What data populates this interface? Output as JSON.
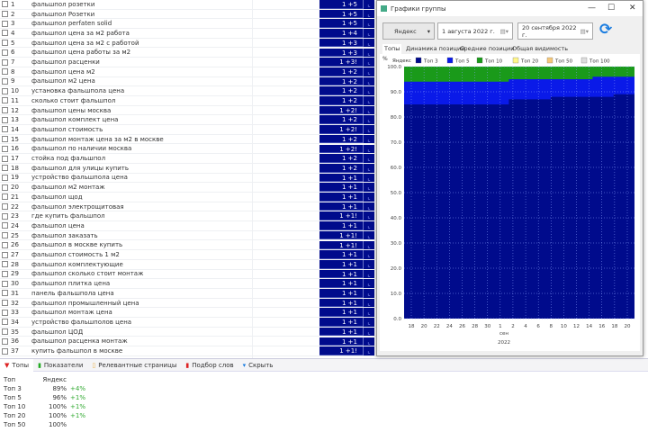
{
  "keywords": [
    {
      "n": "1",
      "kw": "фальшпол розетки",
      "pos": "1 +5"
    },
    {
      "n": "2",
      "kw": "фальшпол Розетки",
      "pos": "1 +5"
    },
    {
      "n": "3",
      "kw": "фальшпол perfaten solid",
      "pos": "1 +5"
    },
    {
      "n": "4",
      "kw": "фальшпол цена за м2 работа",
      "pos": "1 +4"
    },
    {
      "n": "5",
      "kw": "фальшпол цена за м2 с работой",
      "pos": "1 +3"
    },
    {
      "n": "6",
      "kw": "фальшпол цена работы за м2",
      "pos": "1 +3"
    },
    {
      "n": "7",
      "kw": "фальшпол расценки",
      "pos": "1 +3!"
    },
    {
      "n": "8",
      "kw": "фальшпол цена м2",
      "pos": "1 +2"
    },
    {
      "n": "9",
      "kw": "фальшпол м2 цена",
      "pos": "1 +2"
    },
    {
      "n": "10",
      "kw": "установка фальшпола цена",
      "pos": "1 +2"
    },
    {
      "n": "11",
      "kw": "сколько стоит фальшпол",
      "pos": "1 +2"
    },
    {
      "n": "12",
      "kw": "фальшпол цены москва",
      "pos": "1 +2!"
    },
    {
      "n": "13",
      "kw": "фальшпол комплект цена",
      "pos": "1 +2"
    },
    {
      "n": "14",
      "kw": "фальшпол стоимость",
      "pos": "1 +2!"
    },
    {
      "n": "15",
      "kw": "фальшпол монтаж цена за м2 в москве",
      "pos": "1 +2"
    },
    {
      "n": "16",
      "kw": "фальшпол по наличии москва",
      "pos": "1 +2!"
    },
    {
      "n": "17",
      "kw": "стойка под фальшпол",
      "pos": "1 +2"
    },
    {
      "n": "18",
      "kw": "фальшпол для улицы купить",
      "pos": "1 +2"
    },
    {
      "n": "19",
      "kw": "устройство фальшпола цена",
      "pos": "1 +1"
    },
    {
      "n": "20",
      "kw": "фальшпол м2 монтаж",
      "pos": "1 +1"
    },
    {
      "n": "21",
      "kw": "фальшпол щод",
      "pos": "1 +1"
    },
    {
      "n": "22",
      "kw": "фальшпол электрощитовая",
      "pos": "1 +1"
    },
    {
      "n": "23",
      "kw": "где купить фальшпол",
      "pos": "1 +1!"
    },
    {
      "n": "24",
      "kw": "фальшпол цена",
      "pos": "1 +1"
    },
    {
      "n": "25",
      "kw": "фальшпол заказать",
      "pos": "1 +1!"
    },
    {
      "n": "26",
      "kw": "фальшпол в москве купить",
      "pos": "1 +1!"
    },
    {
      "n": "27",
      "kw": "фальшпол стоимость 1 м2",
      "pos": "1 +1"
    },
    {
      "n": "28",
      "kw": "фальшпол комплектующие",
      "pos": "1 +1"
    },
    {
      "n": "29",
      "kw": "фальшпол сколько стоит монтаж",
      "pos": "1 +1"
    },
    {
      "n": "30",
      "kw": "фальшпол плитка цена",
      "pos": "1 +1"
    },
    {
      "n": "31",
      "kw": "панель фальшпола цена",
      "pos": "1 +1"
    },
    {
      "n": "32",
      "kw": "фальшпол промышленный цена",
      "pos": "1 +1"
    },
    {
      "n": "33",
      "kw": "фальшпол монтаж цена",
      "pos": "1 +1"
    },
    {
      "n": "34",
      "kw": "устройство фальшполов цена",
      "pos": "1 +1"
    },
    {
      "n": "35",
      "kw": "фальшпол ЦОД",
      "pos": "1 +1"
    },
    {
      "n": "36",
      "kw": "фальшпол расценка монтаж",
      "pos": "1 +1"
    },
    {
      "n": "37",
      "kw": "купить фальшпол в москве",
      "pos": "1 +1!"
    }
  ],
  "bottom": {
    "tabs": [
      {
        "label": "Топы",
        "icon": "pin-icon"
      },
      {
        "label": "Показатели",
        "icon": "bars-green-icon"
      },
      {
        "label": "Релевантные страницы",
        "icon": "page-icon"
      },
      {
        "label": "Подбор слов",
        "icon": "bars-red-icon"
      },
      {
        "label": "Скрыть",
        "icon": "triangle-down-icon"
      }
    ],
    "table": {
      "headers": [
        "Топ",
        "Яндекс"
      ],
      "rows": [
        {
          "top": "Топ 3",
          "val": "89%",
          "delta": "+4%"
        },
        {
          "top": "Топ 5",
          "val": "96%",
          "delta": "+1%"
        },
        {
          "top": "Топ 10",
          "val": "100%",
          "delta": "+1%"
        },
        {
          "top": "Топ 20",
          "val": "100%",
          "delta": "+1%"
        },
        {
          "top": "Топ 50",
          "val": "100%",
          "delta": ""
        }
      ]
    }
  },
  "window": {
    "title": "Графики группы",
    "engine": "Яндекс",
    "date_from": "1 августа  2022 г.",
    "date_to": "20 сентября 2022 г.",
    "tabs": [
      "Топы",
      "Динамика позиций",
      "Средние позиции",
      "Общая видимость"
    ],
    "colors": {
      "top3": "#000b8c",
      "top5": "#0a1ae8",
      "top10": "#1a9a1a",
      "top20": "#fff68a",
      "top50": "#f5c87a",
      "top100": "#dddddd"
    }
  },
  "chart_data": {
    "type": "area",
    "ylabel": "%",
    "legend_title": "Яндекс",
    "ylim": [
      0,
      100
    ],
    "yticks": [
      "100.0",
      "90.0",
      "80.0",
      "70.0",
      "60.0",
      "50.0",
      "40.0",
      "30.0",
      "20.0",
      "10.0",
      "0.0"
    ],
    "xtick_labels": [
      "18",
      "20",
      "22",
      "24",
      "26",
      "28",
      "30",
      "1",
      "2",
      "4",
      "6",
      "8",
      "10",
      "12",
      "14",
      "16",
      "18",
      "20"
    ],
    "xlabel": "сен",
    "xlabel2": "2022",
    "series_names": [
      "Топ 3",
      "Топ 5",
      "Топ 10",
      "Топ 20",
      "Топ 50",
      "Топ 100"
    ],
    "x": [
      "08-17",
      "08-20",
      "08-24",
      "08-28",
      "09-01",
      "09-02",
      "09-05",
      "09-08",
      "09-12",
      "09-16",
      "09-20",
      "09-21"
    ],
    "series": [
      {
        "name": "Топ 3",
        "values": [
          85,
          85,
          85,
          85,
          85,
          87,
          87,
          88,
          88,
          88,
          89,
          89
        ]
      },
      {
        "name": "Топ 5",
        "values": [
          94,
          94,
          94,
          94,
          94,
          95,
          95,
          95,
          95,
          96,
          96,
          96
        ]
      },
      {
        "name": "Топ 10",
        "values": [
          100,
          100,
          100,
          100,
          100,
          100,
          100,
          100,
          100,
          100,
          100,
          100
        ]
      }
    ]
  }
}
